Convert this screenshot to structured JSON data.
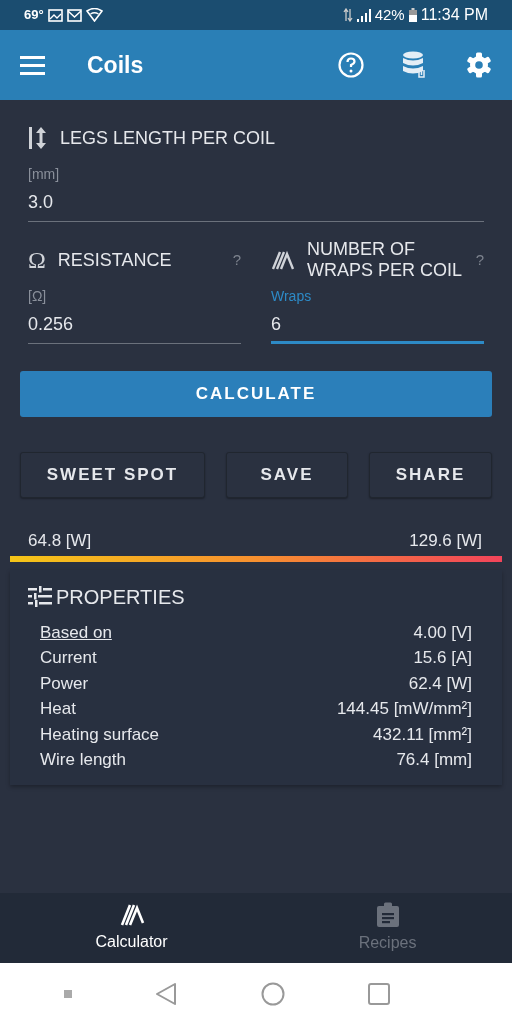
{
  "status_bar": {
    "temperature": "69°",
    "battery_percent": "42%",
    "time": "11:34 PM"
  },
  "app_bar": {
    "title": "Coils"
  },
  "fields": [
    {
      "kind": "length",
      "label": "LEGS LENGTH PER COIL",
      "hint": "[mm]",
      "value": "3.0",
      "focused": false
    },
    {
      "kind": "resistance",
      "symbol": "Ω",
      "label": "RESISTANCE",
      "help": "?",
      "hint": "[Ω]",
      "value": "0.256",
      "focused": false
    },
    {
      "kind": "wraps",
      "label": "NUMBER OF WRAPS PER COIL",
      "help": "?",
      "hint": "Wraps",
      "value": "6",
      "focused": true
    }
  ],
  "calculate_button": "CALCULATE",
  "action_buttons": [
    "SWEET SPOT",
    "SAVE",
    "SHARE"
  ],
  "power_range": {
    "min": "64.8 [W]",
    "max": "129.6 [W]"
  },
  "properties": {
    "title": "PROPERTIES",
    "rows": [
      {
        "kind": "link",
        "label": "Based on",
        "value": "4.00 [V]"
      },
      {
        "kind": "text",
        "label": "Current",
        "value": "15.6 [A]"
      },
      {
        "kind": "text",
        "label": "Power",
        "value": "62.4 [W]"
      },
      {
        "kind": "text",
        "label": "Heat",
        "value": "144.45 [mW/mm²]"
      },
      {
        "kind": "text",
        "label": "Heating surface",
        "value": "432.11 [mm²]"
      },
      {
        "kind": "text",
        "label": "Wire length",
        "value": "76.4 [mm]"
      }
    ]
  },
  "bottom_nav": [
    {
      "kind": "calculator",
      "label": "Calculator",
      "selected": true
    },
    {
      "kind": "recipes",
      "label": "Recipes",
      "selected": false
    }
  ]
}
